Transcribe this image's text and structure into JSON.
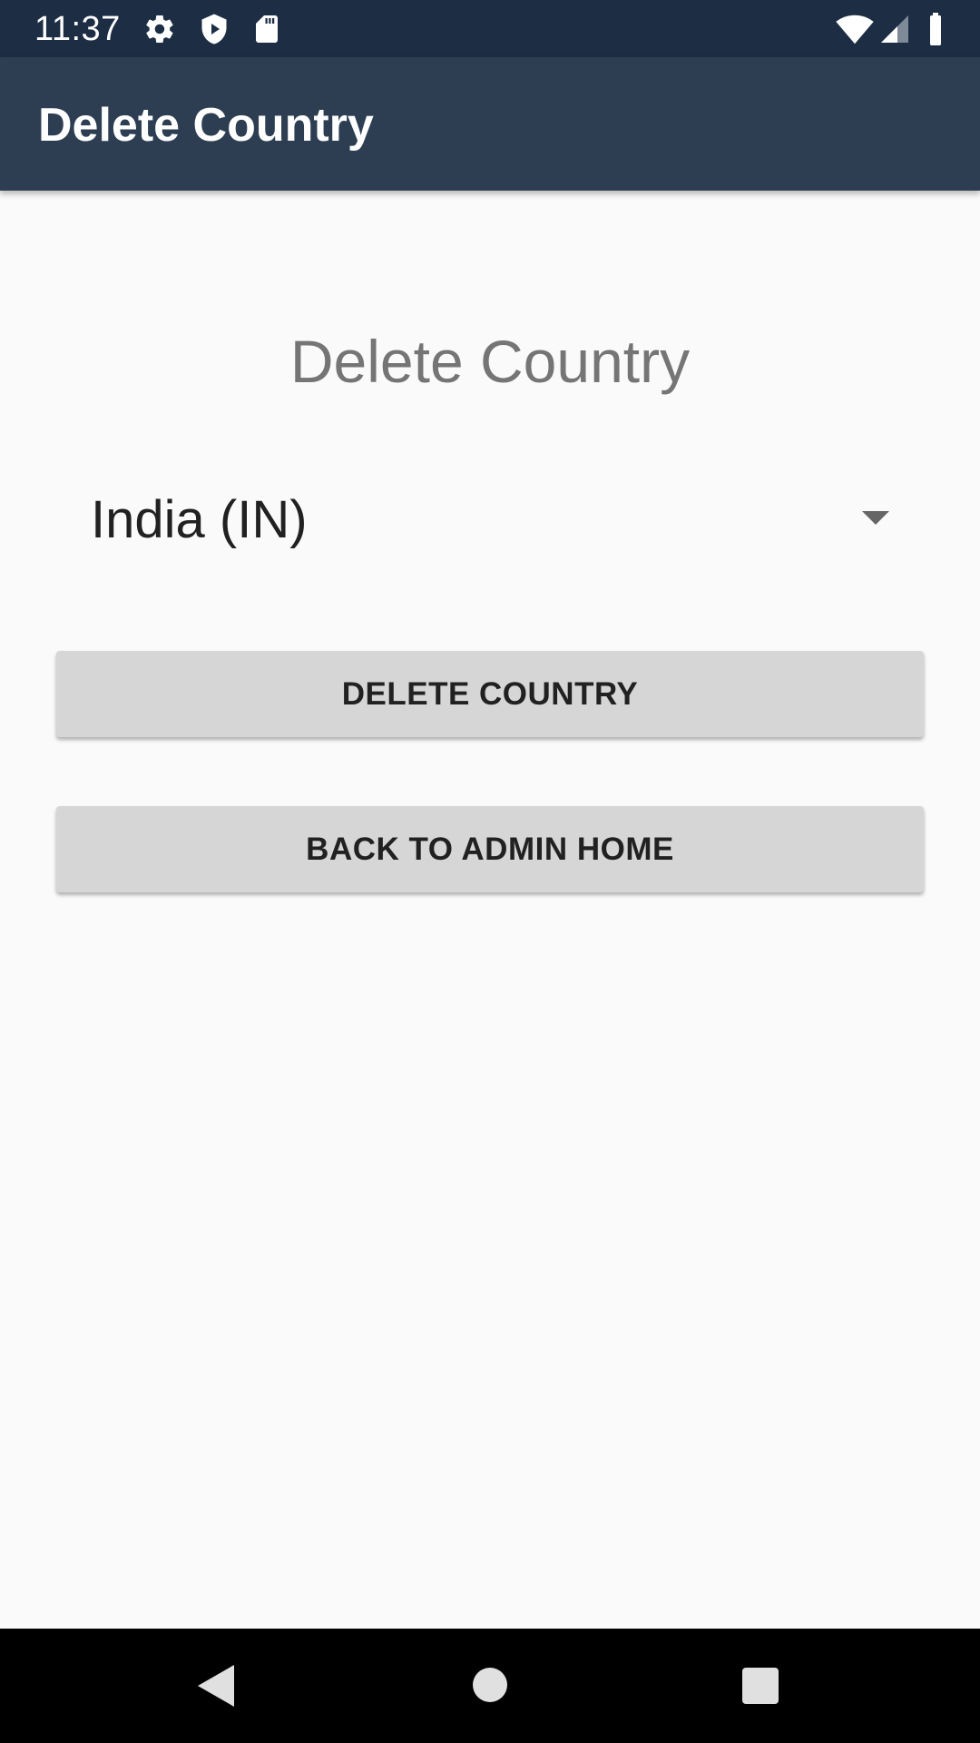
{
  "status_bar": {
    "time": "11:37",
    "icons": [
      "gear-icon",
      "shield-icon",
      "sd-card-icon",
      "wifi-icon",
      "signal-icon",
      "battery-icon"
    ]
  },
  "app_bar": {
    "title": "Delete Country"
  },
  "main": {
    "heading": "Delete Country",
    "country_spinner": {
      "selected": "India (IN)"
    },
    "delete_button_label": "DELETE COUNTRY",
    "back_button_label": "BACK TO ADMIN HOME"
  },
  "nav_bar": {
    "icons": [
      "back-icon",
      "home-icon",
      "recents-icon"
    ]
  },
  "colors": {
    "status_bar": "#1c2d44",
    "app_bar": "#2e3e52",
    "background": "#fafafa",
    "button": "#d6d6d6",
    "heading_text": "#757575"
  }
}
